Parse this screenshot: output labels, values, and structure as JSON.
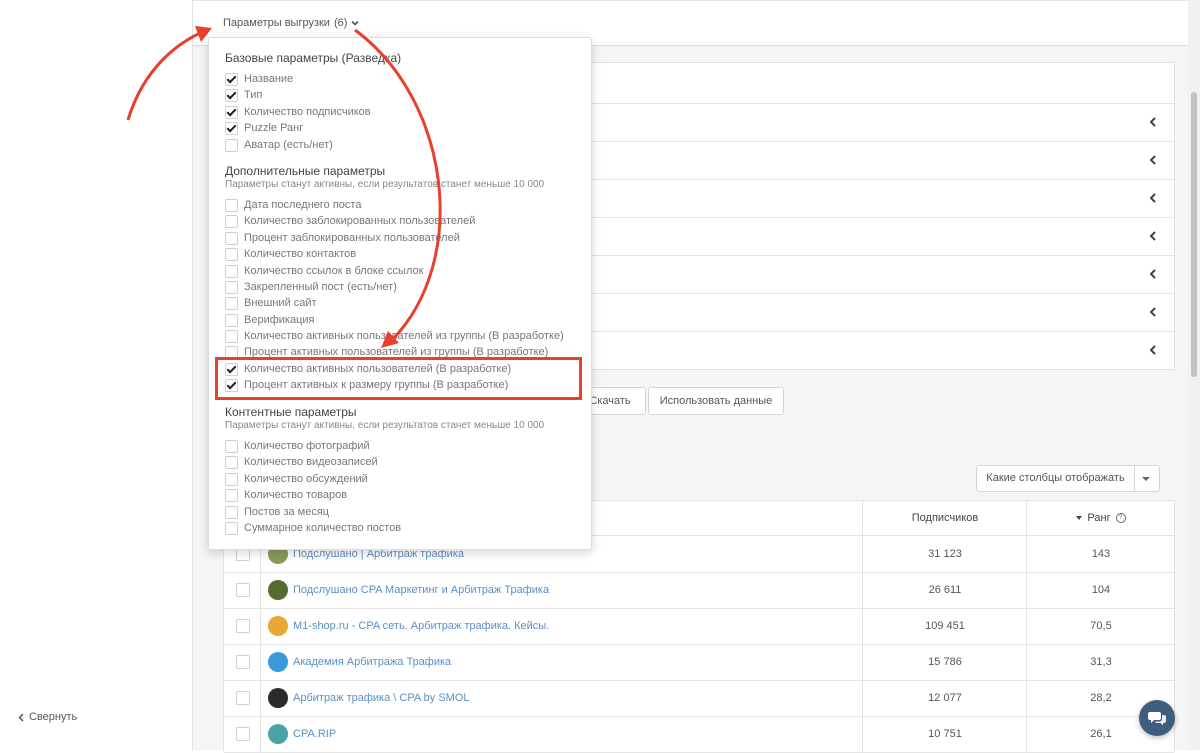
{
  "sidebar": {
    "collapse_label": "Свернуть"
  },
  "header": {
    "params_toggle_label": "Параметры выгрузки",
    "params_count": "(6)"
  },
  "export_panel": {
    "base_section": {
      "title": "Базовые параметры (Разведка)",
      "items": [
        {
          "label": "Название",
          "checked": true
        },
        {
          "label": "Тип",
          "checked": true
        },
        {
          "label": "Количество подписчиков",
          "checked": true
        },
        {
          "label": "Puzzle Ранг",
          "checked": true
        },
        {
          "label": "Аватар (есть/нет)",
          "checked": false
        }
      ]
    },
    "additional_section": {
      "title": "Дополнительные параметры",
      "subtitle": "Параметры станут активны, если результатов станет меньше 10 000",
      "items": [
        {
          "label": "Дата последнего поста",
          "checked": false
        },
        {
          "label": "Количество заблокированных пользователей",
          "checked": false
        },
        {
          "label": "Процент заблокированных пользователей",
          "checked": false
        },
        {
          "label": "Количество контактов",
          "checked": false
        },
        {
          "label": "Количество ссылок в блоке ссылок",
          "checked": false
        },
        {
          "label": "Закрепленный пост (есть/нет)",
          "checked": false
        },
        {
          "label": "Внешний сайт",
          "checked": false
        },
        {
          "label": "Верификация",
          "checked": false
        },
        {
          "label": "Количество активных пользователей из группы (В разработке)",
          "checked": false
        },
        {
          "label": "Процент активных пользователей из группы (В разработке)",
          "checked": false
        },
        {
          "label": "Количество активных пользователей (В разработке)",
          "checked": true
        },
        {
          "label": "Процент активных к размеру группы (В разработке)",
          "checked": true
        }
      ]
    },
    "content_section": {
      "title": "Контентные параметры",
      "subtitle": "Параметры станут активны, если результатов станет меньше 10 000",
      "items": [
        {
          "label": "Количество фотографий",
          "checked": false
        },
        {
          "label": "Количество видеозаписей",
          "checked": false
        },
        {
          "label": "Количество обсуждений",
          "checked": false
        },
        {
          "label": "Количество товаров",
          "checked": false
        },
        {
          "label": "Постов за месяц",
          "checked": false
        },
        {
          "label": "Суммарное количество постов",
          "checked": false
        }
      ]
    }
  },
  "actions": {
    "download_label": "Скачать",
    "use_data_label": "Использовать данные"
  },
  "columns_select": {
    "label": "Какие столбцы отображать"
  },
  "table": {
    "headers": {
      "subscribers": "Подписчиков",
      "rank": "Ранг"
    },
    "rows": [
      {
        "name": "Подслушано | Арбитраж трафика",
        "subscribers": "31 123",
        "rank": "143"
      },
      {
        "name": "Подслушано CPA Маркетинг и Арбитраж Трафика",
        "subscribers": "26 611",
        "rank": "104"
      },
      {
        "name": "M1-shop.ru - CPA сеть. Арбитраж трафика. Кейсы.",
        "subscribers": "109 451",
        "rank": "70,5"
      },
      {
        "name": "Академия Арбитража Трафика",
        "subscribers": "15 786",
        "rank": "31,3"
      },
      {
        "name": "Арбитраж трафика \\ CPA by SMOL",
        "subscribers": "12 077",
        "rank": "28,2"
      },
      {
        "name": "CPA.RIP",
        "subscribers": "10 751",
        "rank": "26,1"
      }
    ]
  },
  "colors": {
    "accent_red": "#e8402c",
    "link_blue": "#5a8fc7",
    "chat_button": "#3f5d7d"
  }
}
